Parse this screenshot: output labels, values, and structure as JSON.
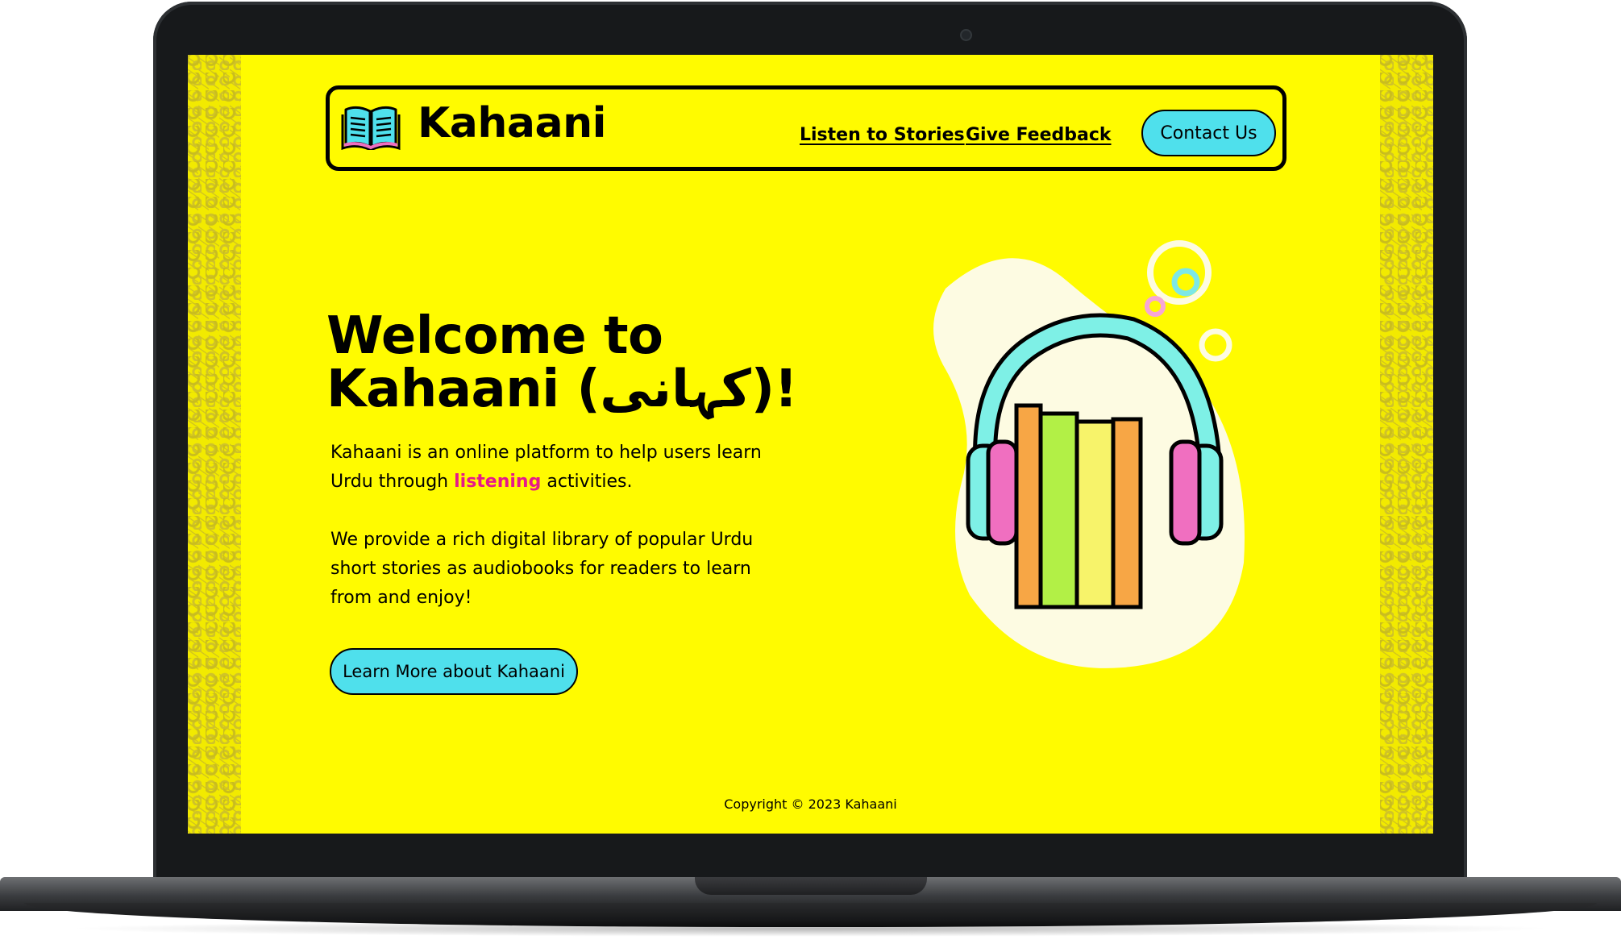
{
  "site": {
    "brand": "Kahaani",
    "nav": {
      "listen": "Listen to Stories",
      "feedback": "Give Feedback",
      "contact": "Contact Us"
    }
  },
  "hero": {
    "title_line1": "Welcome to",
    "title_line2": "Kahaani (کہانی)!",
    "para1_before": "Kahaani is an online platform to help users learn Urdu through ",
    "para1_highlight": "listening",
    "para1_after": " activities.",
    "para2": "We provide a rich digital library of popular Urdu short stories as audiobooks for readers to learn from and enjoy!",
    "cta": "Learn More about Kahaani"
  },
  "footer": {
    "copyright": "Copyright © 2023 Kahaani"
  },
  "icons": {
    "logo": "open-book-icon",
    "illustration": "headphones-books-illustration"
  },
  "colors": {
    "background": "#fffb00",
    "button": "#4fe0ec",
    "highlight": "#e6198a"
  }
}
